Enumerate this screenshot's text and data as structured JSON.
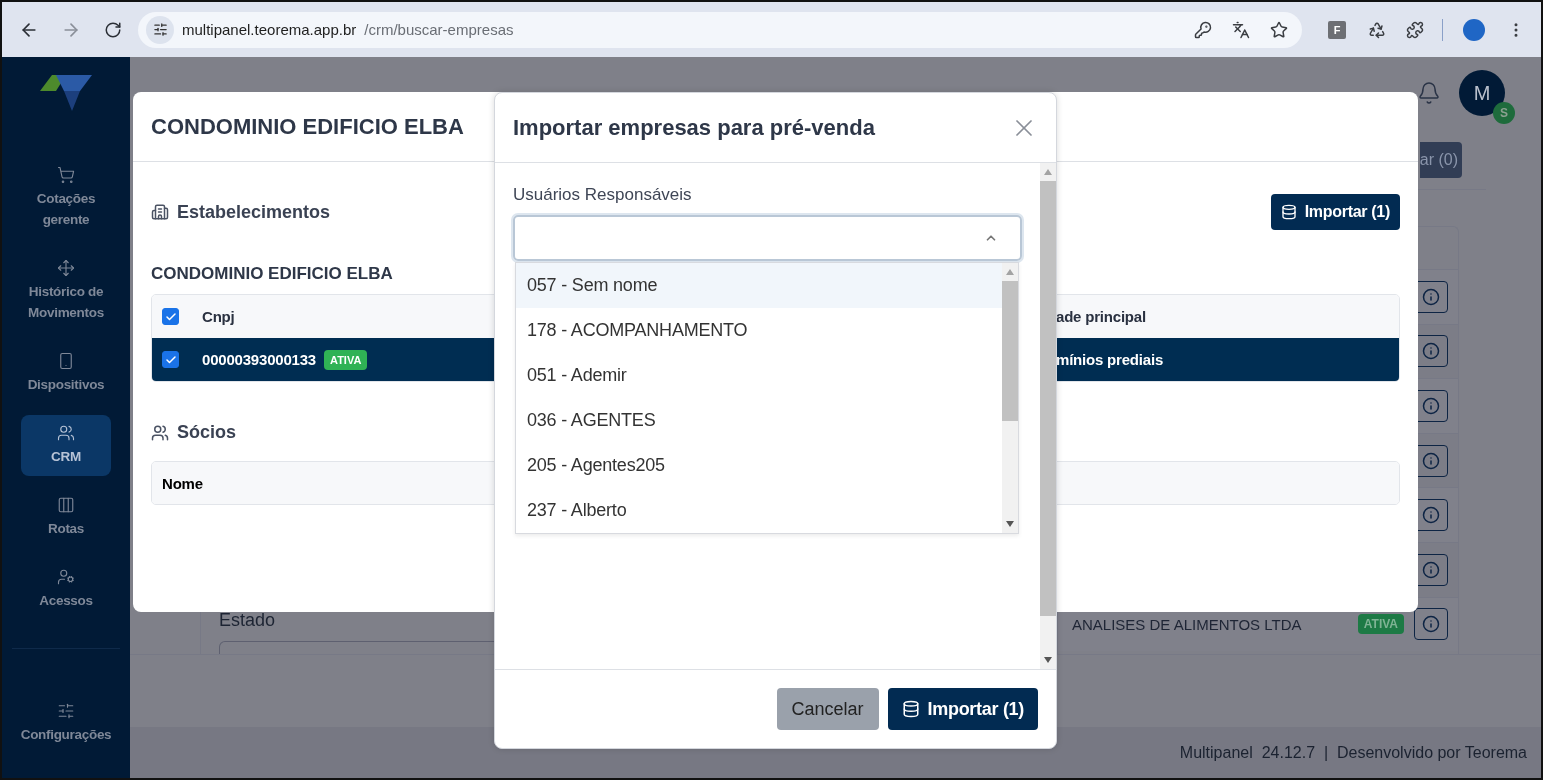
{
  "browser": {
    "url_host": "multipanel.teorema.app.br",
    "url_path": "/crm/buscar-empresas",
    "extension_label": "F"
  },
  "sidebar": {
    "items": [
      {
        "kind": "cart",
        "label": "Cotações gerente",
        "selected": false
      },
      {
        "kind": "move",
        "label": "Histórico de Movimentos",
        "selected": false
      },
      {
        "kind": "phone",
        "label": "Dispositivos",
        "selected": false
      },
      {
        "kind": "users",
        "label": "CRM",
        "selected": true
      },
      {
        "kind": "columns",
        "label": "Rotas",
        "selected": false
      },
      {
        "kind": "access",
        "label": "Acessos",
        "selected": false
      }
    ],
    "settings": {
      "kind": "sliders",
      "label": "Configurações",
      "selected": false
    }
  },
  "header": {
    "avatar_initial": "M",
    "status_badge": "S"
  },
  "background": {
    "button_fragment": "ar (0)",
    "filter_label": "Estado",
    "rows": [
      {
        "kind": "info"
      },
      {
        "kind": "info"
      },
      {
        "kind": "info"
      },
      {
        "kind": "info"
      },
      {
        "kind": "info"
      },
      {
        "kind": "info"
      },
      {
        "kind": "company",
        "name": "ANALISES DE ALIMENTOS LTDA",
        "status": "ATIVA"
      }
    ]
  },
  "company_modal": {
    "title": "CONDOMINIO EDIFICIO ELBA",
    "section_title": "Estabelecimentos",
    "import_button": "Importar (1)",
    "company_name": "CONDOMINIO EDIFICIO ELBA",
    "header_checked": true,
    "columns": [
      "Cnpj",
      "ade principal"
    ],
    "rows": [
      {
        "cnpj": "00000393000133",
        "status": "ATIVA",
        "activity": "mínios prediais",
        "checked": true,
        "selected": true
      }
    ],
    "partners_title": "Sócios",
    "partners_columns": [
      "Nome"
    ]
  },
  "import_modal": {
    "title": "Importar empresas para pré-venda",
    "field_label": "Usuários Responsáveis",
    "expanded": true,
    "options": [
      {
        "label": "057 - Sem nome",
        "highlighted": true
      },
      {
        "label": "178 - ACOMPANHAMENTO",
        "highlighted": false
      },
      {
        "label": "051 - Ademir",
        "highlighted": false
      },
      {
        "label": "036 - AGENTES",
        "highlighted": false
      },
      {
        "label": "205 - Agentes205",
        "highlighted": false
      },
      {
        "label": "237 - Alberto",
        "highlighted": false
      }
    ],
    "cancel_button": "Cancelar",
    "confirm_button": "Importar (1)"
  },
  "footer": {
    "text": "Multipanel  24.12.7  |  Desenvolvido por Teorema"
  }
}
